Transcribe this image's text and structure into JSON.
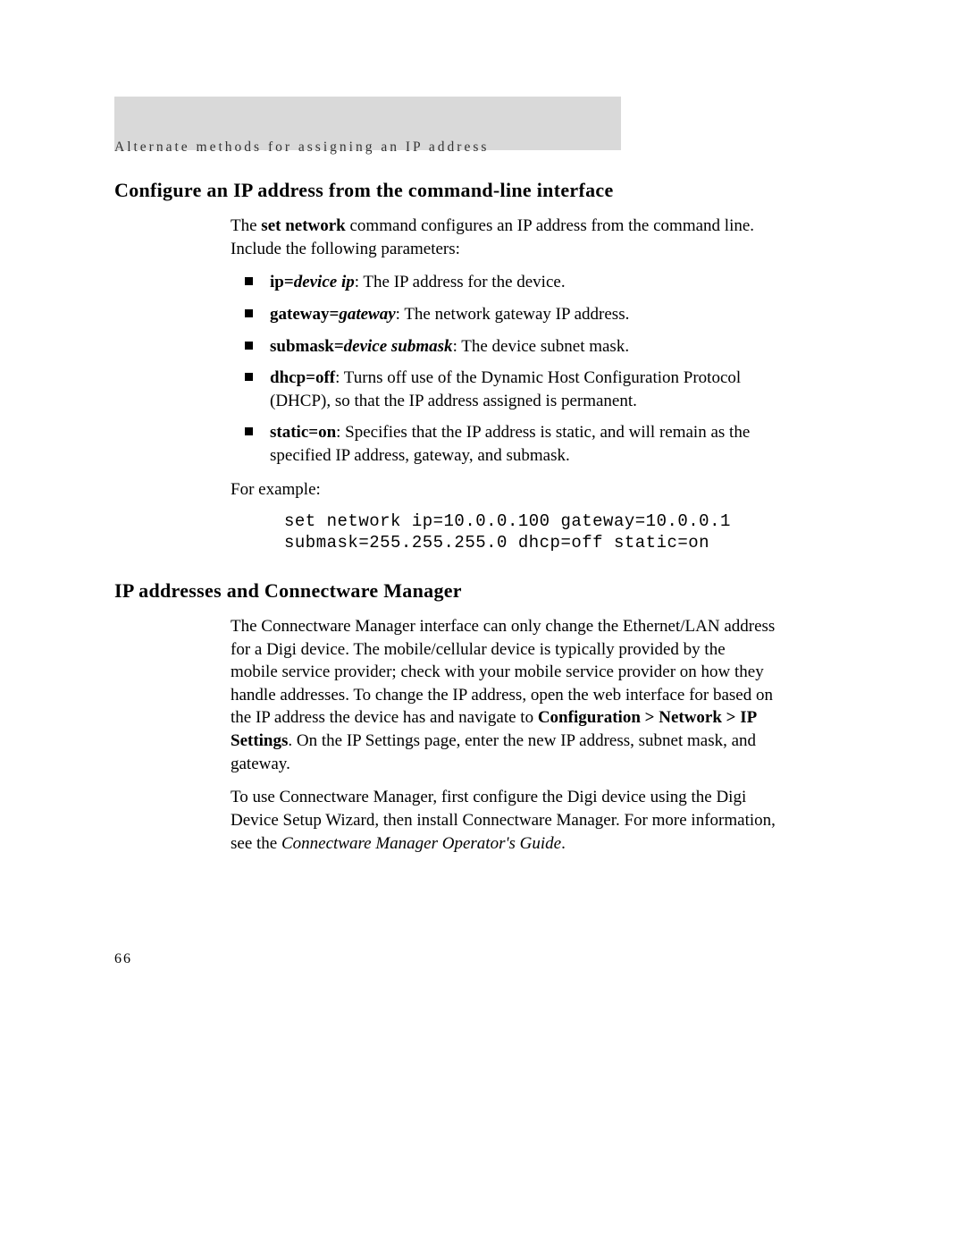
{
  "header": {
    "caption": "Alternate methods for assigning an IP address"
  },
  "section1": {
    "title": "Configure an IP address from the command-line interface",
    "intro_pre": "The ",
    "intro_cmd": "set network",
    "intro_post": " command configures an IP address from the command line. Include the following parameters:",
    "bullets": {
      "b1": {
        "param": "ip=",
        "arg": "device ip",
        "desc": ": The IP address for the device."
      },
      "b2": {
        "param": "gateway=",
        "arg": "gateway",
        "desc": ": The network gateway IP address."
      },
      "b3": {
        "param": "submask=",
        "arg": "device submask",
        "desc": ": The device subnet mask."
      },
      "b4": {
        "param": "dhcp=off",
        "desc": ": Turns off use of the Dynamic Host Configuration Protocol (DHCP), so that the IP address assigned is permanent."
      },
      "b5": {
        "param": "static=on",
        "desc": ": Specifies that the IP address is static, and will remain as the specified IP address, gateway, and submask."
      }
    },
    "example_label": "For example:",
    "example_code": "set network ip=10.0.0.100 gateway=10.0.0.1\nsubmask=255.255.255.0 dhcp=off static=on"
  },
  "section2": {
    "title": "IP addresses and Connectware Manager",
    "para1_pre": "The Connectware Manager interface can only change the Ethernet/LAN address for a Digi device. The mobile/cellular device is typically provided by the mobile service provider; check with your mobile service provider on how they handle addresses. To change the IP address, open the web interface for based on the IP address the device has and navigate to ",
    "para1_nav": "Configuration > Network > IP Settings",
    "para1_post": ". On the IP Settings page, enter the new IP address, subnet mask, and gateway.",
    "para2_pre": "To use Connectware Manager, first configure the Digi device using the Digi Device Setup Wizard, then install Connectware Manager. For more information, see the ",
    "para2_ref": "Connectware Manager Operator's Guide",
    "para2_post": "."
  },
  "page_number": "66"
}
